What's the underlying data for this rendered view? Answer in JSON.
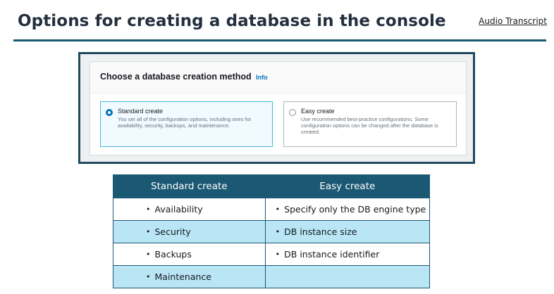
{
  "header": {
    "title": "Options for creating a database in the console",
    "audio_link": "Audio Transcript"
  },
  "screenshot": {
    "panel_title": "Choose a database creation method",
    "info_link": "Info",
    "options": [
      {
        "title": "Standard create",
        "description": "You set all of the configuration options, including ones for availability, security, backups, and maintenance.",
        "selected": true
      },
      {
        "title": "Easy create",
        "description": "Use recommended best-practice configurations. Some configuration options can be changed after the database is created.",
        "selected": false
      }
    ]
  },
  "table": {
    "headers": [
      "Standard create",
      "Easy create"
    ],
    "rows": [
      [
        "Availability",
        "Specify only the DB engine type"
      ],
      [
        "Security",
        "DB instance size"
      ],
      [
        "Backups",
        "DB instance identifier"
      ],
      [
        "Maintenance",
        ""
      ]
    ]
  },
  "colors": {
    "accent": "#1b5873",
    "row_alt": "#b9e5f5",
    "selected_radio": "#0073bb"
  }
}
